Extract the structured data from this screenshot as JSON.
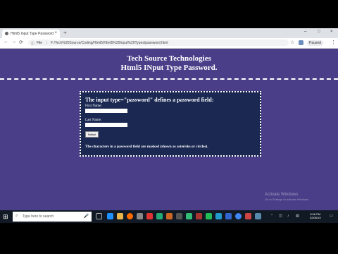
{
  "browser": {
    "tab_title": "Html5 Input Type Password",
    "tab_close": "×",
    "new_tab": "+",
    "win_controls": [
      "–",
      "□",
      "×"
    ],
    "nav": [
      "←",
      "→",
      "⟳"
    ],
    "address": {
      "scheme_label": "File",
      "separator": "|",
      "url": "F:/Tech%20Source/Coding/Html5/Html5%20Input%20Types/password.html"
    },
    "profile_label": "Paused",
    "menu": "⋮"
  },
  "page": {
    "title": "Tech Source Technologies",
    "subtitle": "Html5 INput Type Password.",
    "box_title": "The input type=\"password\" defines a password field:",
    "first_name_label": "First Name:",
    "last_name_label": "Last Name:",
    "submit_label": "Submit",
    "note": "The characters in a password field are masked (shown as asterisks or circles)."
  },
  "watermark": {
    "line1": "Activate Windows",
    "line2": "Go to Settings to activate Windows."
  },
  "taskbar": {
    "search_placeholder": "Type here to search",
    "time": "5:06 PM",
    "date": "02/06/19"
  }
}
